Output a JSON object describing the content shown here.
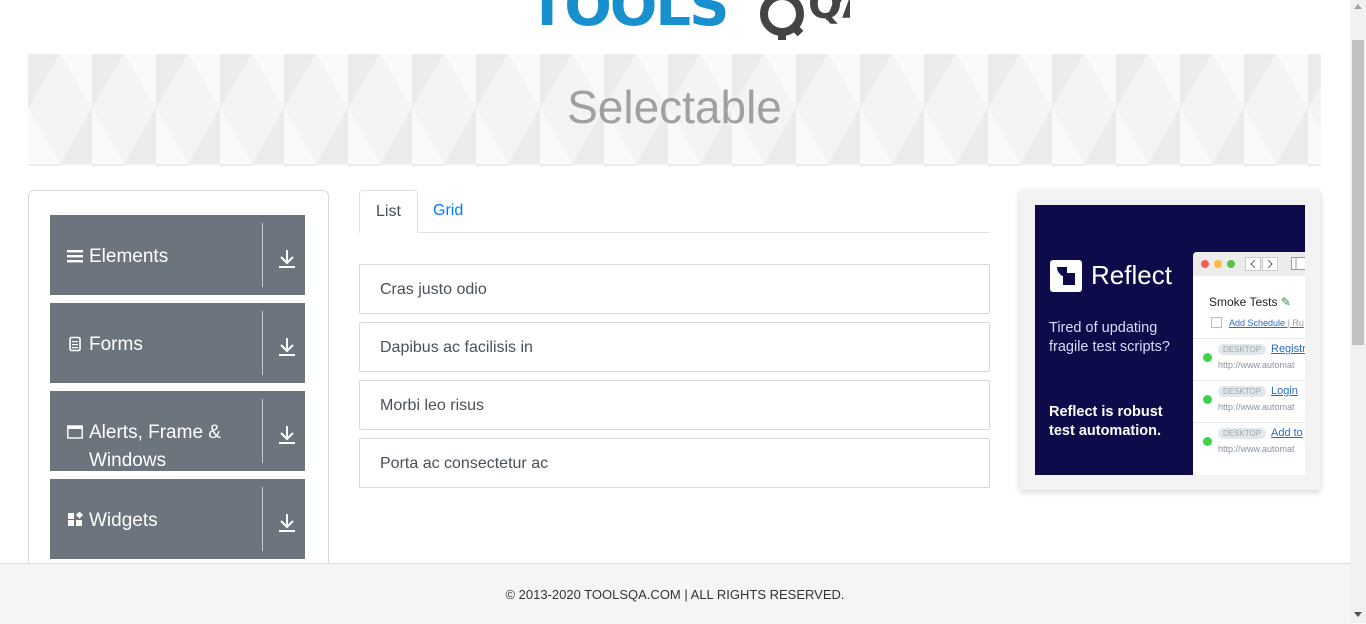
{
  "header": {
    "logo_text_main": "TOOLS",
    "logo_text_qa": "QA"
  },
  "banner": {
    "title": "Selectable"
  },
  "sidebar": {
    "groups": [
      {
        "label": "Elements",
        "icon": "hamburger-icon"
      },
      {
        "label": "Forms",
        "icon": "document-icon"
      },
      {
        "label": "Alerts, Frame & Windows",
        "icon": "window-icon"
      },
      {
        "label": "Widgets",
        "icon": "widgets-icon"
      }
    ]
  },
  "tabs": [
    {
      "label": "List",
      "active": true
    },
    {
      "label": "Grid",
      "active": false
    }
  ],
  "list_items": [
    "Cras justo odio",
    "Dapibus ac facilisis in",
    "Morbi leo risus",
    "Porta ac consectetur ac"
  ],
  "ad": {
    "brand": "Reflect",
    "copy1": "Tired of updating fragile test scripts?",
    "copy2": "Reflect is robust test automation.",
    "window_title": "Smoke Tests",
    "schedule_link": "Add Schedule",
    "schedule_sep": "| Ru",
    "items": [
      {
        "tag": "DESKTOP",
        "link": "Registr",
        "url": "http://www.automat"
      },
      {
        "tag": "DESKTOP",
        "link": "Login",
        "url": "http://www.automat"
      },
      {
        "tag": "DESKTOP",
        "link": "Add to",
        "url": "http://www.automat"
      }
    ]
  },
  "footer": {
    "text": "© 2013-2020 TOOLSQA.COM | ALL RIGHTS RESERVED."
  },
  "colors": {
    "sidebar_group_bg": "#6c757d",
    "link_blue": "#007bff",
    "ad_bg": "#0d0b4a",
    "logo_blue": "#1890ce"
  }
}
